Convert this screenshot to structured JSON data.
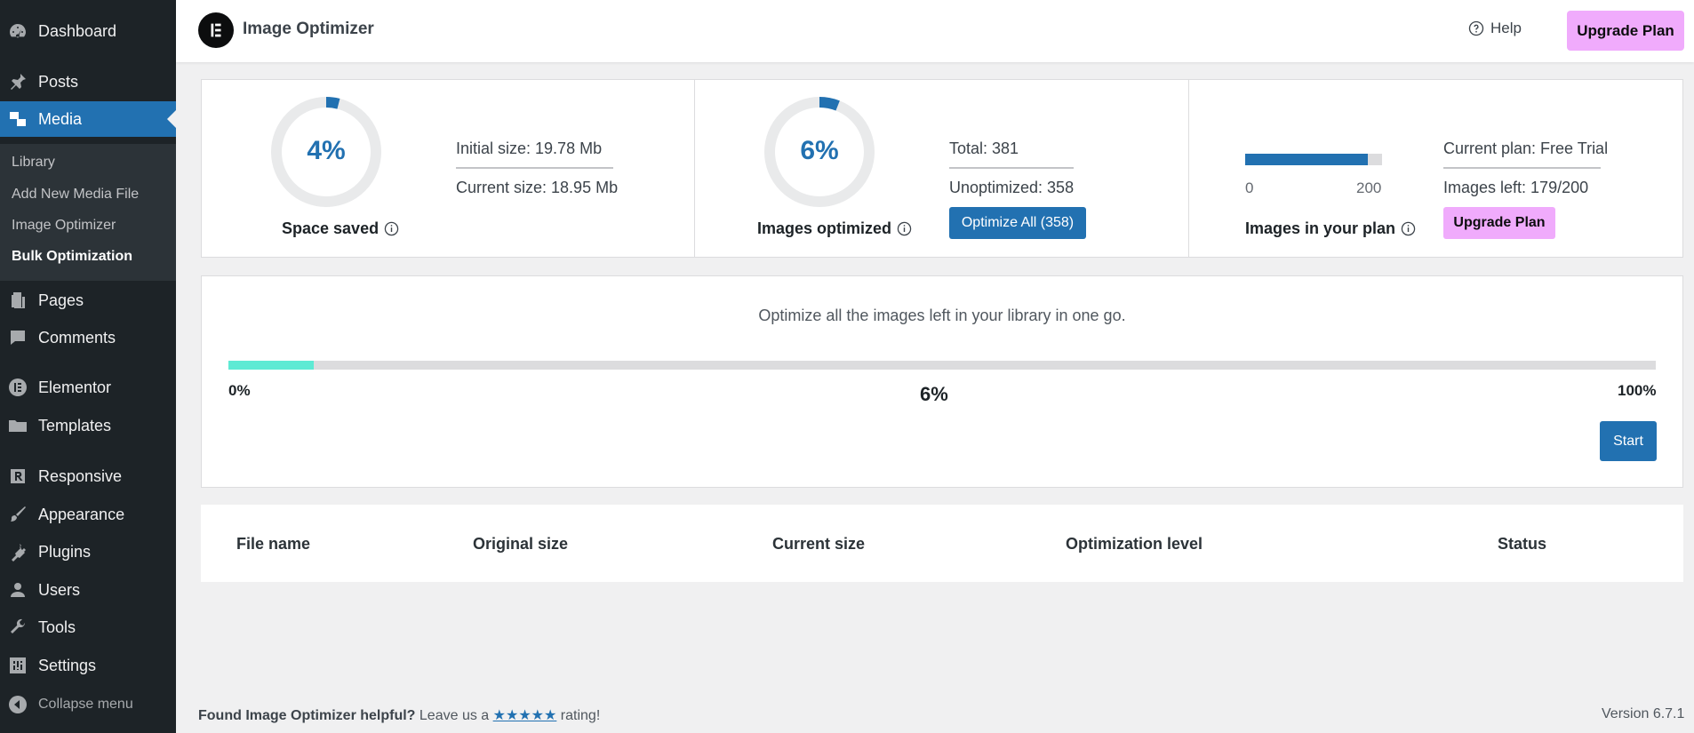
{
  "sidebar": {
    "items": [
      {
        "label": "Dashboard",
        "icon": "dashboard-icon"
      },
      {
        "label": "Posts",
        "icon": "pin-icon"
      },
      {
        "label": "Media",
        "icon": "media-icon"
      },
      {
        "label": "Pages",
        "icon": "pages-icon"
      },
      {
        "label": "Comments",
        "icon": "comments-icon"
      },
      {
        "label": "Elementor",
        "icon": "elementor-icon"
      },
      {
        "label": "Templates",
        "icon": "folder-icon"
      },
      {
        "label": "Responsive",
        "icon": "responsive-icon"
      },
      {
        "label": "Appearance",
        "icon": "brush-icon"
      },
      {
        "label": "Plugins",
        "icon": "plugin-icon"
      },
      {
        "label": "Users",
        "icon": "user-icon"
      },
      {
        "label": "Tools",
        "icon": "wrench-icon"
      },
      {
        "label": "Settings",
        "icon": "settings-icon"
      }
    ],
    "submenu": [
      "Library",
      "Add New Media File",
      "Image Optimizer",
      "Bulk Optimization"
    ],
    "collapse_label": "Collapse menu"
  },
  "header": {
    "title": "Image Optimizer",
    "help_label": "Help",
    "upgrade_label": "Upgrade Plan"
  },
  "stats": {
    "space_saved": {
      "percent_label": "4%",
      "percent_value": 4,
      "label": "Space saved",
      "initial_size": "Initial size: 19.78 Mb",
      "current_size": "Current size: 18.95 Mb"
    },
    "images_optimized": {
      "percent_label": "6%",
      "percent_value": 6,
      "label": "Images optimized",
      "total": "Total: 381",
      "unoptimized": "Unoptimized: 358",
      "button_label": "Optimize All (358)"
    },
    "plan": {
      "label": "Images in your plan",
      "axis_min": "0",
      "axis_max": "200",
      "used_fraction": 0.895,
      "current_plan": "Current plan: Free Trial",
      "images_left": "Images left: 179/200",
      "button_label": "Upgrade Plan"
    }
  },
  "bulk": {
    "description": "Optimize all the images left in your library in one go.",
    "min_label": "0%",
    "max_label": "100%",
    "current_label": "6%",
    "progress_value": 6,
    "start_label": "Start"
  },
  "table": {
    "columns": [
      "File name",
      "Original size",
      "Current size",
      "Optimization level",
      "Status"
    ]
  },
  "footer": {
    "prefix": "Found Image Optimizer helpful?",
    "middle": " Leave us a ",
    "stars": "★★★★★",
    "suffix": " rating!",
    "version": "Version 6.7.1"
  },
  "colors": {
    "accent": "#2271b1",
    "pink": "#f0abfc",
    "progress": "#5eead4",
    "sidebar": "#1d2327"
  }
}
